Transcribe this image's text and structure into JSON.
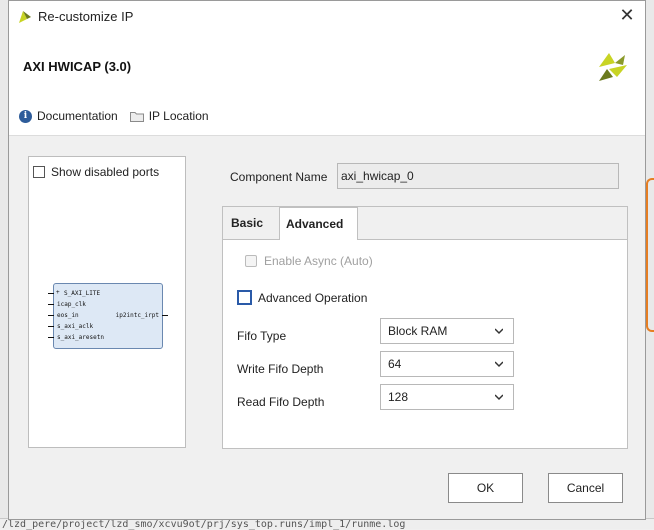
{
  "window": {
    "title": "Re-customize IP"
  },
  "header": {
    "ip_title": "AXI HWICAP (3.0)",
    "documentation_label": "Documentation",
    "ip_location_label": "IP Location"
  },
  "left_panel": {
    "show_disabled_ports_label": "Show disabled ports",
    "ports_left": [
      "S_AXI_LITE",
      "icap_clk",
      "eos_in",
      "s_axi_aclk",
      "s_axi_aresetn"
    ],
    "ports_right": [
      "ip2intc_irpt"
    ]
  },
  "component": {
    "label": "Component Name",
    "value": "axi_hwicap_0"
  },
  "tabs": {
    "basic": "Basic",
    "advanced": "Advanced"
  },
  "advanced": {
    "enable_async_label": "Enable Async (Auto)",
    "advanced_operation_label": "Advanced Operation",
    "fifo_type": {
      "label": "Fifo Type",
      "value": "Block RAM"
    },
    "write_fifo_depth": {
      "label": "Write Fifo Depth",
      "value": "64"
    },
    "read_fifo_depth": {
      "label": "Read Fifo Depth",
      "value": "128"
    }
  },
  "buttons": {
    "ok": "OK",
    "cancel": "Cancel"
  },
  "background": {
    "path_text": "/lzd_pere/project/lzd_smo/xcvu9ot/prj/sys_top.runs/impl_1/runme.log"
  },
  "colors": {
    "accent": "#2a5aa8",
    "info": "#2e5c9a",
    "block_fill": "#dde8f5",
    "brand_yellow": "#c8d424",
    "brand_green": "#6b7a1e"
  }
}
